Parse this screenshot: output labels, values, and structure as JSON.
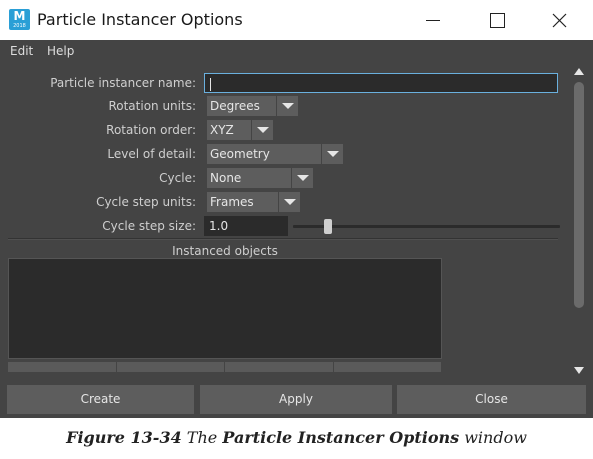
{
  "window": {
    "app_icon_letter": "M",
    "app_icon_sub": "2018",
    "title": "Particle Instancer Options"
  },
  "menubar": {
    "items": [
      "Edit",
      "Help"
    ]
  },
  "form": {
    "name_label": "Particle instancer name:",
    "name_value": "",
    "rotation_units_label": "Rotation units:",
    "rotation_units_value": "Degrees",
    "rotation_order_label": "Rotation order:",
    "rotation_order_value": "XYZ",
    "level_of_detail_label": "Level of detail:",
    "level_of_detail_value": "Geometry",
    "cycle_label": "Cycle:",
    "cycle_value": "None",
    "cycle_step_units_label": "Cycle step units:",
    "cycle_step_units_value": "Frames",
    "cycle_step_size_label": "Cycle step size:",
    "cycle_step_size_value": "1.0",
    "cycle_step_size_slider_fraction": 0.12
  },
  "instanced_objects": {
    "title": "Instanced objects"
  },
  "buttons": {
    "create": "Create",
    "apply": "Apply",
    "close": "Close"
  },
  "caption": {
    "figure": "Figure 13-34",
    "pre": "The",
    "bold": "Particle Instancer Options",
    "post": "window"
  },
  "colors": {
    "panel_bg": "#444444",
    "field_bg": "#2b2b2b",
    "dropdown_bg": "#5d5d5d",
    "focus_border": "#6ab0de",
    "app_icon": "#2a9fd6"
  }
}
